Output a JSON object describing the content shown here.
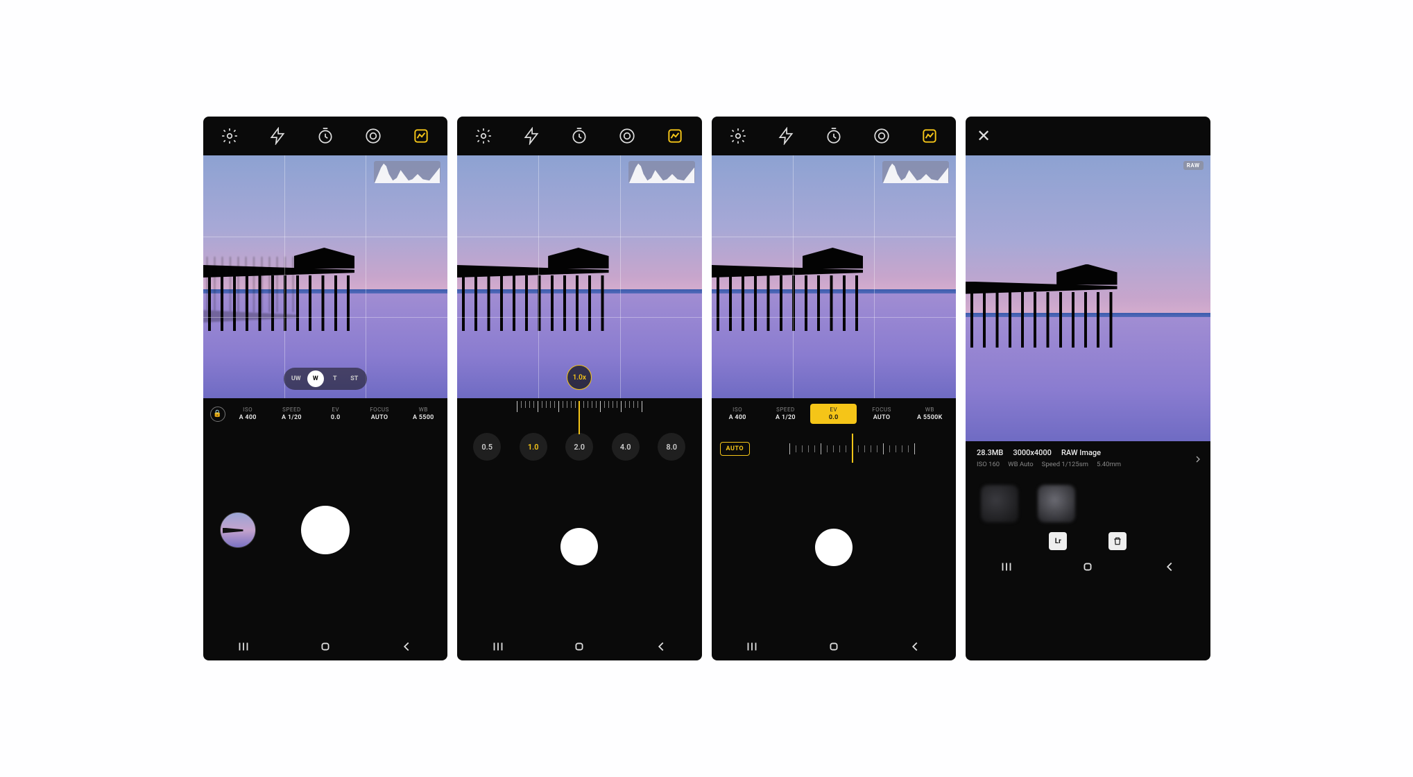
{
  "screen1": {
    "top_icons": [
      "settings",
      "flash",
      "timer",
      "metering",
      "histogram"
    ],
    "lens_options": [
      "UW",
      "W",
      "T",
      "ST"
    ],
    "lens_active_index": 1,
    "params": [
      {
        "label": "ISO",
        "value": "A 400"
      },
      {
        "label": "SPEED",
        "value": "A 1/20"
      },
      {
        "label": "EV",
        "value": "0.0"
      },
      {
        "label": "FOCUS",
        "value": "AUTO"
      },
      {
        "label": "WB",
        "value": "A 5500"
      }
    ]
  },
  "screen2": {
    "zoom_indicator": "1.0x",
    "zoom_stops": [
      "0.5",
      "1.0",
      "2.0",
      "4.0",
      "8.0"
    ],
    "zoom_active_index": 1
  },
  "screen3": {
    "params": [
      {
        "label": "ISO",
        "value": "A 400"
      },
      {
        "label": "SPEED",
        "value": "A 1/20"
      },
      {
        "label": "EV",
        "value": "0.0",
        "active": true
      },
      {
        "label": "FOCUS",
        "value": "AUTO"
      },
      {
        "label": "WB",
        "value": "A 5500K"
      }
    ],
    "auto_label": "AUTO"
  },
  "screen4": {
    "raw_badge": "RAW",
    "info": {
      "size": "28.3MB",
      "dimensions": "3000x4000",
      "type": "RAW Image",
      "iso": "ISO 160",
      "wb": "WB Auto",
      "speed": "Speed 1/125sm",
      "focal": "5.40mm"
    },
    "action_labels": [
      "Lr",
      "trash"
    ]
  }
}
